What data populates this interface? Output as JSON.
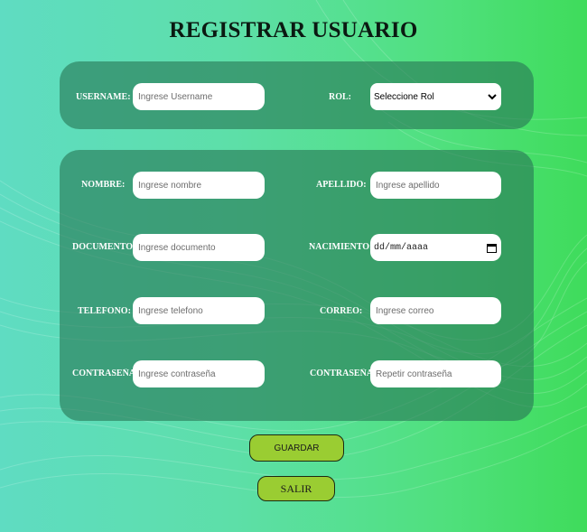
{
  "page": {
    "title": "REGISTRAR USUARIO"
  },
  "account_panel": {
    "username": {
      "label": "USERNAME:",
      "placeholder": "Ingrese Username"
    },
    "rol": {
      "label": "ROL:",
      "selected": "Seleccione Rol"
    }
  },
  "details_panel": {
    "nombre": {
      "label": "NOMBRE:",
      "placeholder": "Ingrese nombre"
    },
    "apellido": {
      "label": "APELLIDO:",
      "placeholder": "Ingrese apellido"
    },
    "documento": {
      "label": "DOCUMENTO:",
      "placeholder": "Ingrese documento"
    },
    "nacimiento": {
      "label": "NACIMIENTO:",
      "value": "dd/mm/aaaa"
    },
    "telefono": {
      "label": "TELEFONO:",
      "placeholder": "Ingrese telefono"
    },
    "correo": {
      "label": "CORREO:",
      "placeholder": "Ingrese correo"
    },
    "contrasena": {
      "label": "CONTRASEÑA:",
      "placeholder": "Ingrese contraseña"
    },
    "repetir_contrasena": {
      "label": "CONTRASEÑA:",
      "placeholder": "Repetir contraseña"
    }
  },
  "actions": {
    "save_label": "GUARDAR",
    "exit_label": "SALIR"
  },
  "colors": {
    "panel": "#2f7a58",
    "button": "#9acd32",
    "title": "#0b1a12"
  }
}
